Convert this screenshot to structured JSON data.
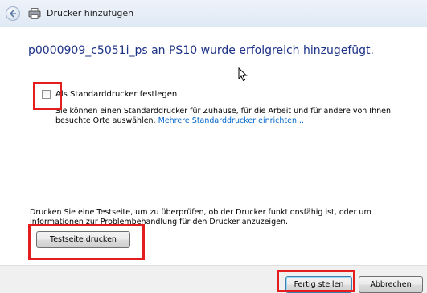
{
  "window": {
    "title": "Drucker hinzufügen"
  },
  "icons": {
    "back": "back-arrow-icon",
    "printer": "printer-icon",
    "cursor": "mouse-cursor-icon"
  },
  "main": {
    "headline": "p0000909_c5051i_ps an PS10 wurde erfolgreich hinzugefügt.",
    "default_checkbox": {
      "label": "Als Standarddrucker festlegen",
      "checked": false
    },
    "description": "Sie können einen Standarddrucker für Zuhause, für die Arbeit und für andere von Ihnen besuchte Orte auswählen.",
    "description_link": "Mehrere Standarddrucker einrichten...",
    "test_info": "Drucken Sie eine Testseite, um zu überprüfen, ob der Drucker funktionsfähig ist, oder um Informationen zur Problembehandlung für den Drucker anzuzeigen.",
    "test_button": "Testseite drucken"
  },
  "footer": {
    "finish_button": "Fertig stellen",
    "cancel_button": "Abbrechen"
  },
  "colors": {
    "headline": "#1e3287",
    "link": "#0066cc",
    "highlight": "#e41e1e",
    "footer_bg": "#f0f0f0"
  }
}
